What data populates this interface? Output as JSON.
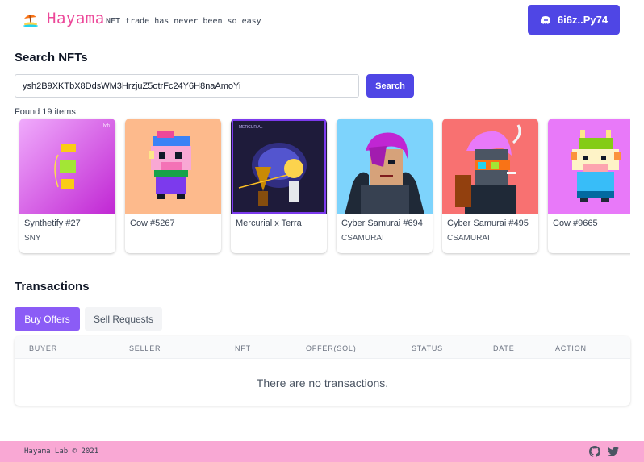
{
  "header": {
    "brand": "Hayama",
    "tagline": "NFT trade has never been so easy",
    "wallet_label": "6i6z..Py74",
    "logo_icon": "beach-umbrella-icon",
    "wallet_icon": "phantom-ghost-icon"
  },
  "search": {
    "title": "Search NFTs",
    "input_value": "ysh2B9XKTbX8DdsWM3HrzjuZ5otrFc24Y6H8naAmoYi",
    "button_label": "Search",
    "results_text": "Found 19 items"
  },
  "nfts": [
    {
      "name": "Synthetify #27",
      "symbol": "SNY",
      "bg": "#d946ef"
    },
    {
      "name": "Cow #5267",
      "symbol": "",
      "bg": "#fdba8c"
    },
    {
      "name": "Mercurial x Terra",
      "symbol": "",
      "bg": "#1e1b3a"
    },
    {
      "name": "Cyber Samurai #694",
      "symbol": "CSAMURAI",
      "bg": "#7dd3fc"
    },
    {
      "name": "Cyber Samurai #495",
      "symbol": "CSAMURAI",
      "bg": "#f87171"
    },
    {
      "name": "Cow #9665",
      "symbol": "",
      "bg": "#e879f9"
    }
  ],
  "transactions": {
    "title": "Transactions",
    "tabs": [
      "Buy Offers",
      "Sell Requests"
    ],
    "active_tab": "Buy Offers",
    "columns": [
      "BUYER",
      "SELLER",
      "NFT",
      "OFFER(SOL)",
      "STATUS",
      "DATE",
      "ACTION"
    ],
    "empty_text": "There are no transactions."
  },
  "footer": {
    "copyright": "Hayama Lab © 2021",
    "icons": [
      "github-icon",
      "twitter-icon"
    ]
  },
  "colors": {
    "brand": "#ec4899",
    "primary": "#4f46e5",
    "tab_active": "#8b5cf6",
    "footer_bg": "#f9a8d4"
  }
}
